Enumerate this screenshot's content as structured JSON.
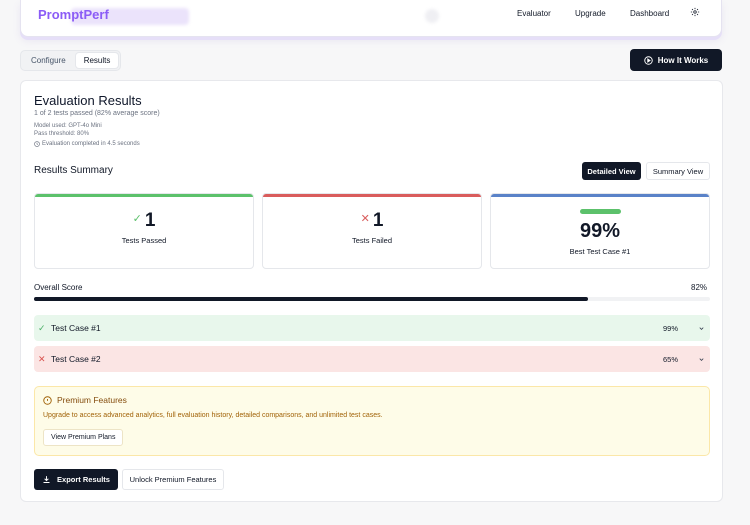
{
  "header": {
    "brand": "PromptPerf",
    "nav": [
      "Evaluator",
      "Upgrade",
      "Dashboard"
    ],
    "settings_icon": "gear-icon"
  },
  "tabs": [
    {
      "label": "Configure",
      "active": false
    },
    {
      "label": "Results",
      "active": true
    }
  ],
  "how_it_works": {
    "label": "How It Works",
    "icon": "play-circle-icon"
  },
  "results": {
    "title": "Evaluation Results",
    "summary_line": "1 of 2 tests passed (82% average score)",
    "model_used": "Model used: GPT-4o Mini",
    "pass_threshold": "Pass threshold: 80%",
    "completed": "Evaluation completed in 4.5 seconds",
    "completed_icon": "clock-icon"
  },
  "results_summary": {
    "title": "Results Summary",
    "detailed_view_label": "Detailed View",
    "summary_view_label": "Summary View",
    "active_view": "Detailed View"
  },
  "stats": {
    "passed": {
      "value": "1",
      "label": "Tests Passed",
      "icon": "check-icon",
      "color": "#5cc16b"
    },
    "failed": {
      "value": "1",
      "label": "Tests Failed",
      "icon": "x-icon",
      "color": "#d95c5c"
    },
    "best": {
      "value": "99%",
      "label": "Best Test Case #1",
      "color": "#5a82c8",
      "pill_color": "#5cc16b"
    }
  },
  "overall": {
    "label": "Overall Score",
    "value_text": "82%",
    "value": 0.82
  },
  "test_cases": [
    {
      "name": "Test Case #1",
      "score": "99%",
      "passed": true,
      "bg": "#e8f7ec",
      "icon_color": "#4caf68"
    },
    {
      "name": "Test Case #2",
      "score": "65%",
      "passed": false,
      "bg": "#fbe5e4",
      "icon_color": "#d9534f"
    }
  ],
  "premium": {
    "title": "Premium Features",
    "description": "Upgrade to access advanced analytics, full evaluation history, detailed comparisons, and unlimited test cases.",
    "button": "View Premium Plans",
    "icon": "info-circle-icon"
  },
  "actions": {
    "export": "Export Results",
    "export_icon": "download-icon",
    "unlock": "Unlock Premium Features"
  }
}
